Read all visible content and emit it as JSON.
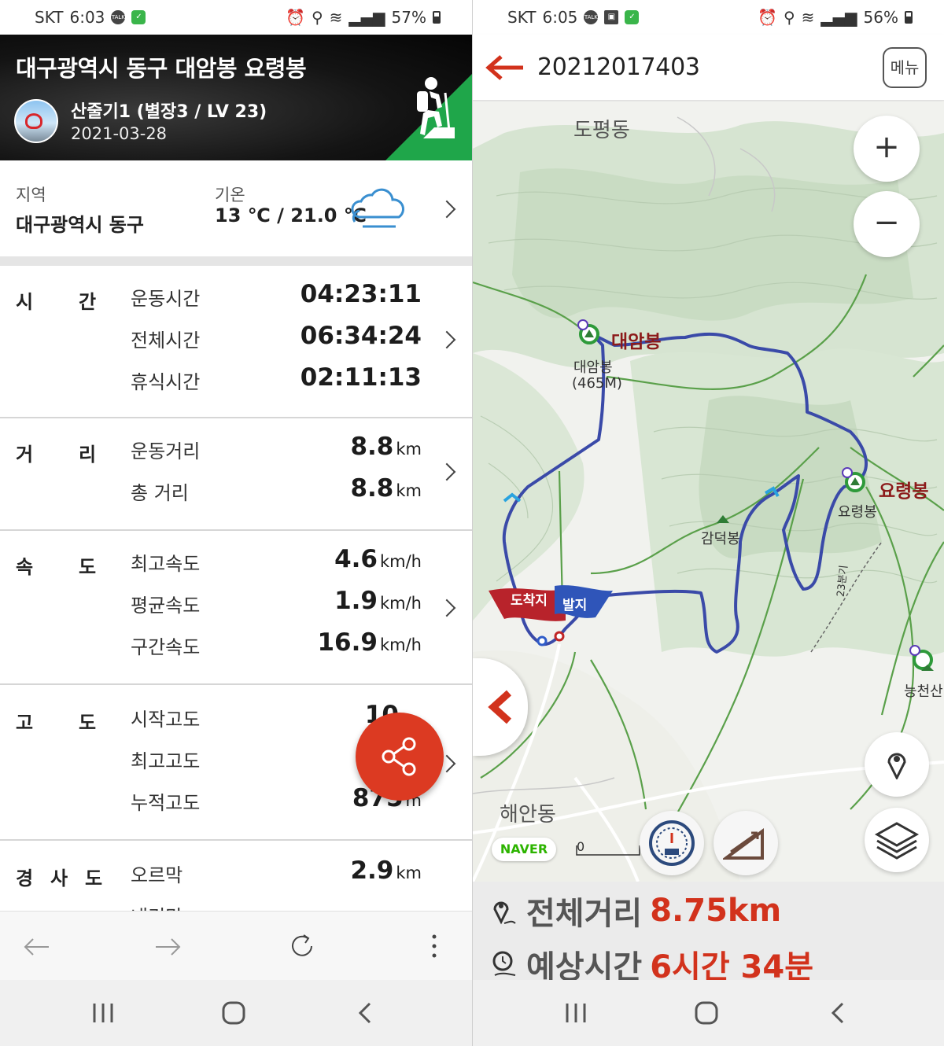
{
  "left": {
    "status": {
      "carrier": "SKT",
      "time": "6:03",
      "battery": "57%",
      "talk_icon": "TALK"
    },
    "header": {
      "title": "대구광역시 동구 대암봉 요령봉",
      "subtitle": "산줄기1 (별장3 / LV 23)",
      "date": "2021-03-28",
      "badge_color": "#1fa64a"
    },
    "region": {
      "area_label": "지역",
      "area_value": "대구광역시 동구",
      "temp_label": "기온",
      "temp_value": "13 ℃ / 21.0 ℃",
      "weather_icon": "cloud-icon"
    },
    "sections": [
      {
        "cat": [
          "시",
          "간"
        ],
        "rows": [
          {
            "k": "운동시간",
            "v": "04:23:11",
            "u": ""
          },
          {
            "k": "전체시간",
            "v": "06:34:24",
            "u": ""
          },
          {
            "k": "휴식시간",
            "v": "02:11:13",
            "u": ""
          }
        ]
      },
      {
        "cat": [
          "거",
          "리"
        ],
        "rows": [
          {
            "k": "운동거리",
            "v": "8.8",
            "u": "km"
          },
          {
            "k": "총 거리",
            "v": "8.8",
            "u": "km"
          }
        ]
      },
      {
        "cat": [
          "속",
          "도"
        ],
        "rows": [
          {
            "k": "최고속도",
            "v": "4.6",
            "u": "km/h"
          },
          {
            "k": "평균속도",
            "v": "1.9",
            "u": "km/h"
          },
          {
            "k": "구간속도",
            "v": "16.9",
            "u": "km/h"
          }
        ]
      },
      {
        "cat": [
          "고",
          "도"
        ],
        "rows": [
          {
            "k": "시작고도",
            "v": "10",
            "u": ""
          },
          {
            "k": "최고고도",
            "v": "",
            "u": ""
          },
          {
            "k": "누적고도",
            "v": "875",
            "u": "m"
          }
        ]
      },
      {
        "cat": [
          "경",
          "사",
          "도"
        ],
        "rows": [
          {
            "k": "오르막",
            "v": "2.9",
            "u": "km"
          },
          {
            "k": "내리막",
            "v": "",
            "u": ""
          }
        ]
      }
    ],
    "fab_icon": "share-icon",
    "accent": "#dc3a22"
  },
  "right": {
    "status": {
      "carrier": "SKT",
      "time": "6:05",
      "battery": "56%",
      "talk_icon": "TALK"
    },
    "header": {
      "track_id": "20212017403",
      "menu_label": "메뉴",
      "back_color": "#d2321c"
    },
    "map": {
      "labels": {
        "dopyeong": "도평동",
        "haeandong": "해안동",
        "daeam_peak": "대암봉",
        "daeam_small": "대암봉",
        "daeam_elev": "(465M)",
        "yoryeong_peak": "요령봉",
        "yoryeong_small": "요령봉",
        "gamdeok": "감덕봉",
        "neungcheon": "능천산",
        "arrival": "도착지",
        "departure": "발지",
        "road": "23분기",
        "naver": "NAVER",
        "scale_zero": "0"
      },
      "route_color": "#3a4aa8",
      "zoom_in": "+",
      "zoom_out": "−"
    },
    "summary": {
      "distance_label": "전체거리",
      "distance_value": "8.75km",
      "time_label": "예상시간",
      "time_value": "6시간 34분"
    }
  }
}
